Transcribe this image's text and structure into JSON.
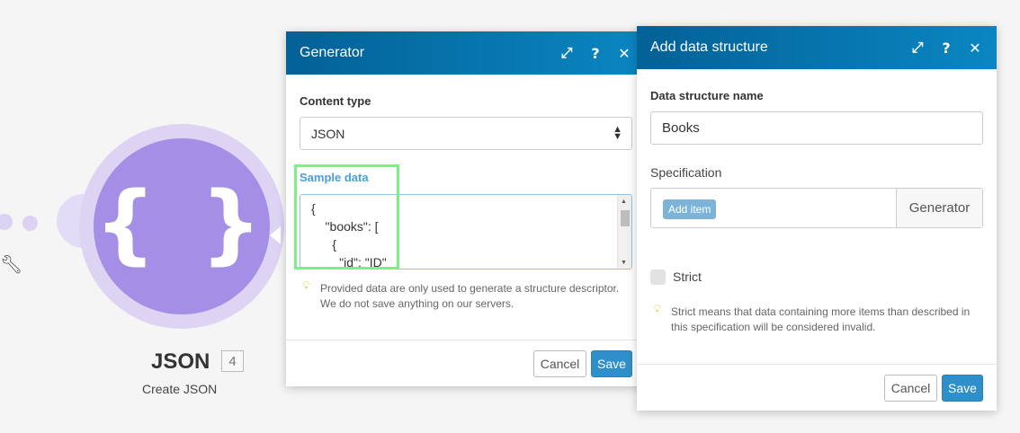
{
  "module": {
    "icon": "{ }",
    "title": "JSON",
    "badge": "4",
    "subtitle": "Create JSON",
    "icon_name": "braces-icon",
    "color": "#a58fe6"
  },
  "generator": {
    "title": "Generator",
    "content_type_label": "Content type",
    "content_type_value": "JSON",
    "sample_data_label": "Sample data",
    "sample_data_value": "{\n    \"books\": [\n      {\n        \"id\": \"ID\"",
    "hint": "Provided data are only used to generate a structure descriptor. We do not save anything on our servers.",
    "cancel_label": "Cancel",
    "save_label": "Save"
  },
  "data_structure": {
    "title": "Add data structure",
    "name_label": "Data structure name",
    "name_value": "Books",
    "spec_label": "Specification",
    "add_item_label": "Add item",
    "generator_label": "Generator",
    "strict_label": "Strict",
    "strict_hint": "Strict means that data containing more items than described in this specification will be considered invalid.",
    "cancel_label": "Cancel",
    "save_label": "Save"
  },
  "header_icons": {
    "expand": "⤢",
    "help": "?",
    "close": "✕"
  },
  "colors": {
    "header_start": "#036196",
    "header_end": "#0a86c2",
    "save_button": "#2f8fcb",
    "highlight": "#7bf084"
  }
}
